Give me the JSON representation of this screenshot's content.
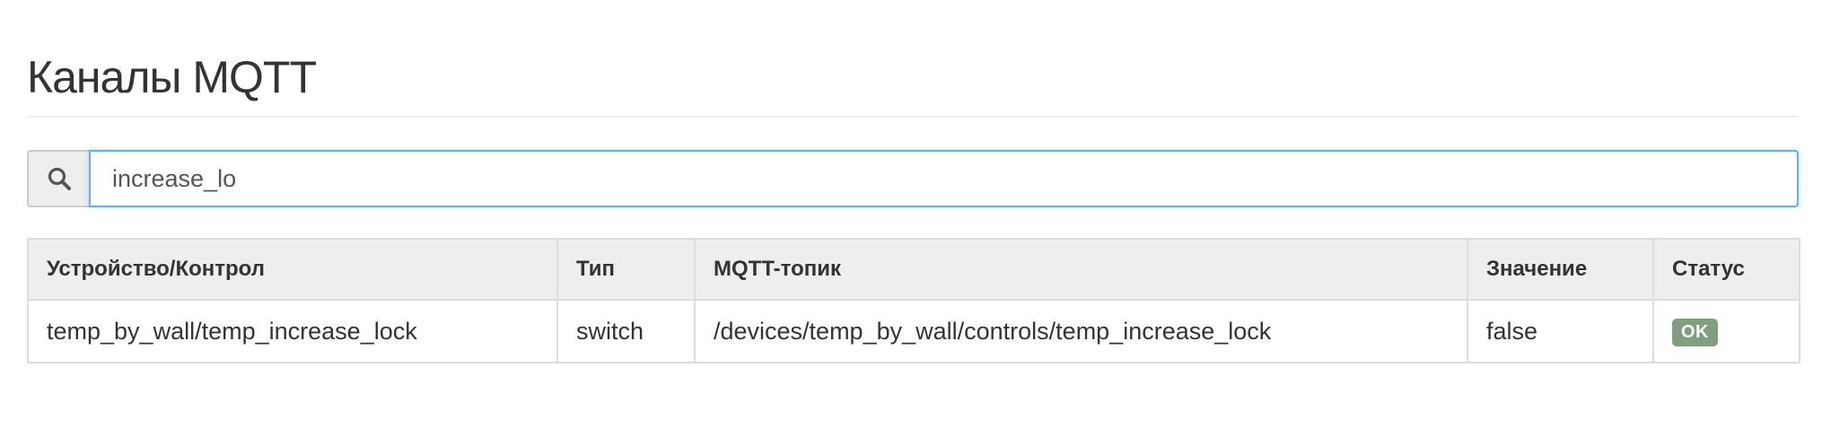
{
  "page": {
    "title": "Каналы MQTT"
  },
  "search": {
    "icon": "search-icon",
    "value": "increase_lo"
  },
  "table": {
    "columns": [
      "Устройство/Контрол",
      "Тип",
      "MQTT-топик",
      "Значение",
      "Статус"
    ],
    "rows": [
      {
        "device_control": "temp_by_wall/temp_increase_lock",
        "type": "switch",
        "topic": "/devices/temp_by_wall/controls/temp_increase_lock",
        "value": "false",
        "status": "OK"
      }
    ]
  },
  "colors": {
    "status_ok": "#7f9f7f",
    "focus_border": "#66afe9",
    "header_bg": "#eeeeee"
  }
}
